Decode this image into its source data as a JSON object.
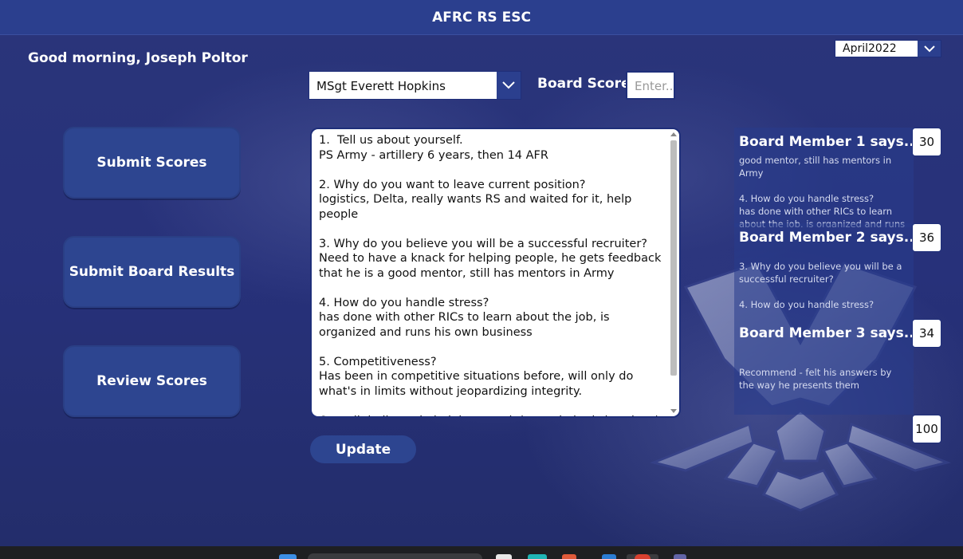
{
  "app": {
    "title": "AFRC RS ESC",
    "greeting": "Good morning, Joseph Poltor"
  },
  "month_select": {
    "value": "April2022"
  },
  "person_select": {
    "value": "MSgt Everett Hopkins"
  },
  "board_score": {
    "label": "Board Score",
    "placeholder": "Enter.."
  },
  "nav": {
    "submit_scores": "Submit Scores",
    "submit_board_results": "Submit Board Results",
    "review_scores": "Review Scores"
  },
  "notes": {
    "text": "1.  Tell us about yourself.\nPS Army - artillery 6 years, then 14 AFR\n\n2. Why do you want to leave current position?\nlogistics, Delta, really wants RS and waited for it, help people\n\n3. Why do you believe you will be a successful recruiter?\nNeed to have a knack for helping people, he gets feedback that he is a good mentor, still has mentors in Army\n\n4. How do you handle stress?\nhas done with other RICs to learn about the job, is organized and runs his own business\n\n5. Competitiveness?\nHas been in competitive situations before, will only do what's in limits without jeopardizing integrity.\n\nOverall: believes in helping people(some in bad situations), location SE TC, raised in South, sales stations, skip TX, knows"
  },
  "update_button": "Update",
  "board_members": [
    {
      "title": "Board Member 1 says...",
      "score": "30",
      "comment": "good mentor, still has mentors in Army\n\n4. How do you handle stress?\nhas done with other RICs to learn about the job, is organized and runs"
    },
    {
      "title": "Board Member 2 says...",
      "score": "36",
      "comment": "3. Why do you believe you will be a successful recruiter?\n\n4. How do you handle stress?"
    },
    {
      "title": "Board Member 3 says...",
      "score": "34",
      "comment": "Recommend - felt his answers by the way he presents them"
    }
  ],
  "total_score": "100",
  "colors": {
    "header": "#2b3f8e",
    "background": "#27317a",
    "button": "#2d4590"
  }
}
